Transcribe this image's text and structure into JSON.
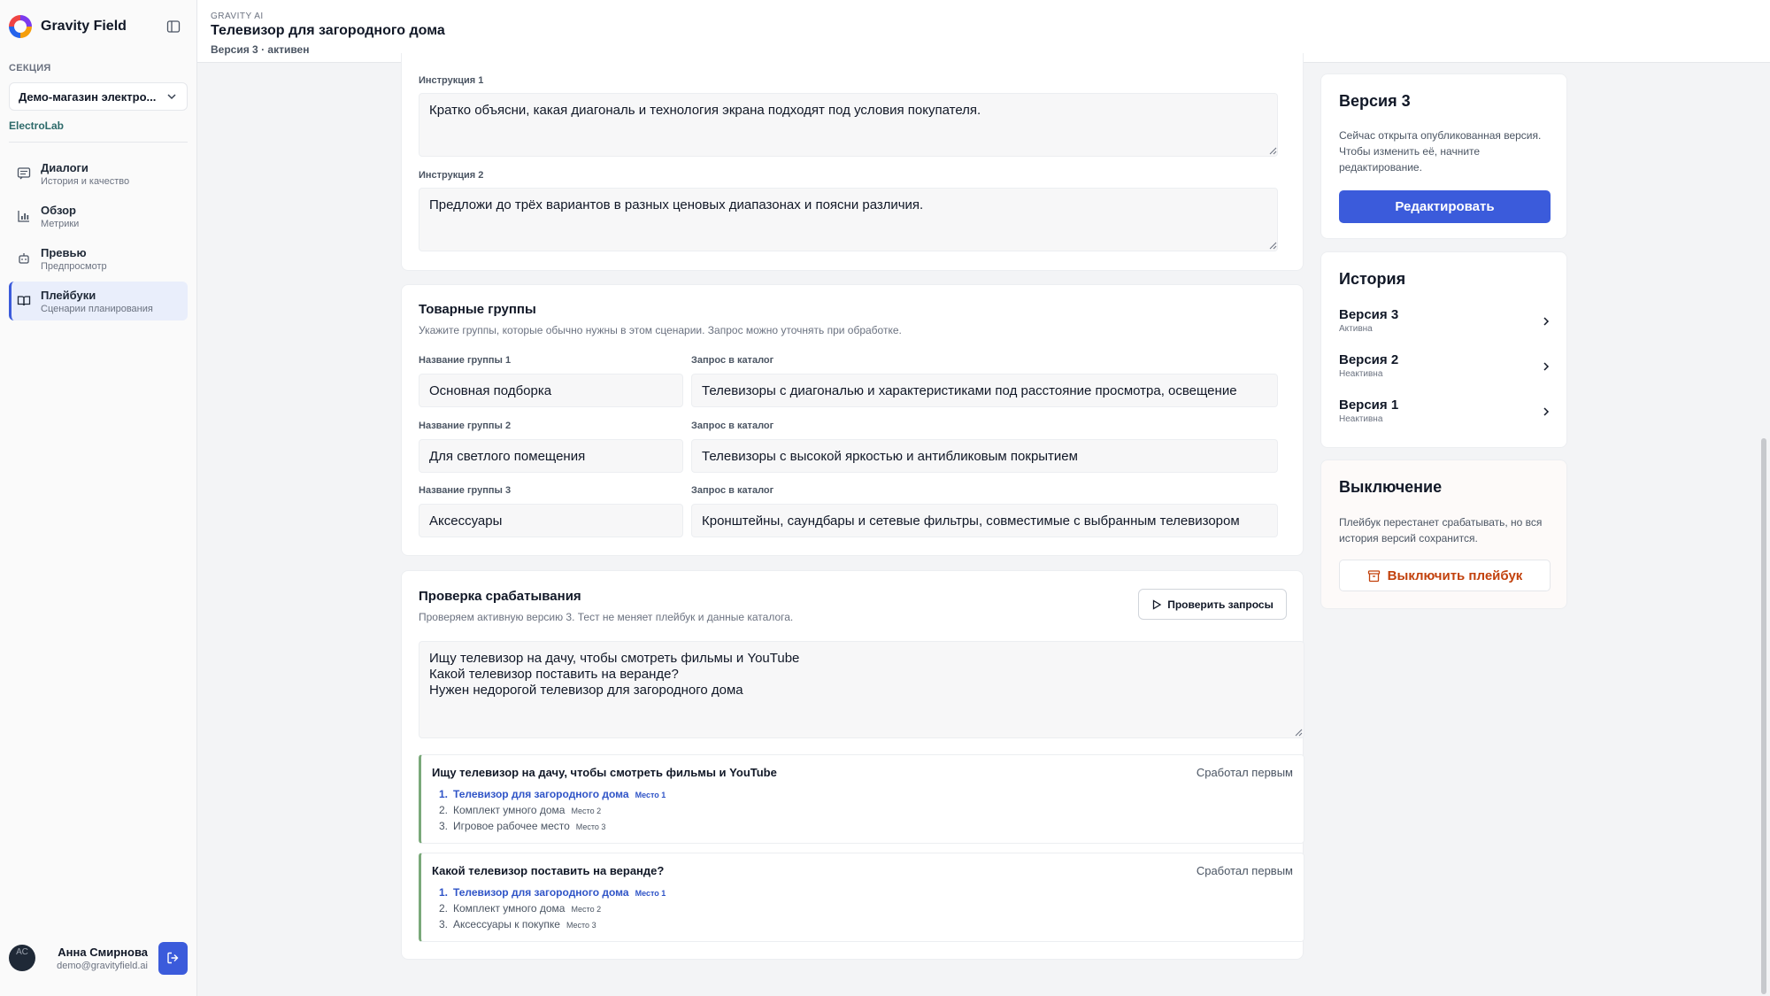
{
  "sidebar": {
    "brand": "Gravity Field",
    "section_label": "СЕКЦИЯ",
    "section_value": "Демо-магазин электро...",
    "org": "ElectroLab",
    "nav": [
      {
        "title": "Диалоги",
        "sub": "История и качество",
        "icon": "chat-icon"
      },
      {
        "title": "Обзор",
        "sub": "Метрики",
        "icon": "bar-chart-icon"
      },
      {
        "title": "Превью",
        "sub": "Предпросмотр",
        "icon": "robot-icon"
      },
      {
        "title": "Плейбуки",
        "sub": "Сценарии планирования",
        "icon": "book-icon"
      }
    ],
    "user": {
      "initials": "АС",
      "name": "Анна Смирнова",
      "email": "demo@gravityfield.ai"
    }
  },
  "header": {
    "overline": "GRAVITY AI",
    "title": "Телевизор для загородного дома",
    "subtitle": "Версия 3 · активен"
  },
  "instructions": [
    {
      "label": "Инструкция 1",
      "value": "Кратко объясни, какая диагональ и технология экрана подходят под условия покупателя."
    },
    {
      "label": "Инструкция 2",
      "value": "Предложи до трёх вариантов в разных ценовых диапазонах и поясни различия."
    }
  ],
  "groups": {
    "title": "Товарные группы",
    "desc": "Укажите группы, которые обычно нужны в этом сценарии. Запрос можно уточнять при обработке.",
    "items": [
      {
        "name_label": "Название группы 1",
        "name": "Основная подборка",
        "query_label": "Запрос в каталог",
        "query": "Телевизоры с диагональю и характеристиками под расстояние просмотра, освещение"
      },
      {
        "name_label": "Название группы 2",
        "name": "Для светлого помещения",
        "query_label": "Запрос в каталог",
        "query": "Телевизоры с высокой яркостью и антибликовым покрытием"
      },
      {
        "name_label": "Название группы 3",
        "name": "Аксессуары",
        "query_label": "Запрос в каталог",
        "query": "Кронштейны, саундбары и сетевые фильтры, совместимые с выбранным телевизором"
      }
    ]
  },
  "check": {
    "title": "Проверка срабатывания",
    "desc": "Проверяем активную версию 3. Тест не меняет плейбук и данные каталога.",
    "button": "Проверить запросы",
    "queries": [
      "Ищу телевизор на дачу, чтобы смотреть фильмы и YouTube",
      "Какой телевизор поставить на веранде?",
      "Нужен недорогой телевизор для загородного дома"
    ],
    "results": [
      {
        "query": "Ищу телевизор на дачу, чтобы смотреть фильмы и YouTube",
        "status": "Сработал первым",
        "items": [
          {
            "num": "1.",
            "name": "Телевизор для загородного дома",
            "place": "Место 1"
          },
          {
            "num": "2.",
            "name": "Комплект умного дома",
            "place": "Место 2"
          },
          {
            "num": "3.",
            "name": "Игровое рабочее место",
            "place": "Место 3"
          }
        ]
      },
      {
        "query": "Какой телевизор поставить на веранде?",
        "status": "Сработал первым",
        "items": [
          {
            "num": "1.",
            "name": "Телевизор для загородного дома",
            "place": "Место 1"
          },
          {
            "num": "2.",
            "name": "Комплект умного дома",
            "place": "Место 2"
          },
          {
            "num": "3.",
            "name": "Аксессуары к покупке",
            "place": "Место 3"
          }
        ]
      }
    ]
  },
  "version_card": {
    "title": "Версия 3",
    "desc": "Сейчас открыта опубликованная версия. Чтобы изменить её, начните редактирование.",
    "button": "Редактировать"
  },
  "history": {
    "title": "История",
    "items": [
      {
        "name": "Версия 3",
        "status": "Активна"
      },
      {
        "name": "Версия 2",
        "status": "Неактивна"
      },
      {
        "name": "Версия 1",
        "status": "Неактивна"
      }
    ]
  },
  "disable": {
    "title": "Выключение",
    "desc": "Плейбук перестанет срабатывать, но вся история версий сохранится.",
    "button": "Выключить плейбук"
  },
  "colors": {
    "accent": "#3b5bdb",
    "danger": "#c2410c",
    "success_border": "#7aa97a"
  }
}
